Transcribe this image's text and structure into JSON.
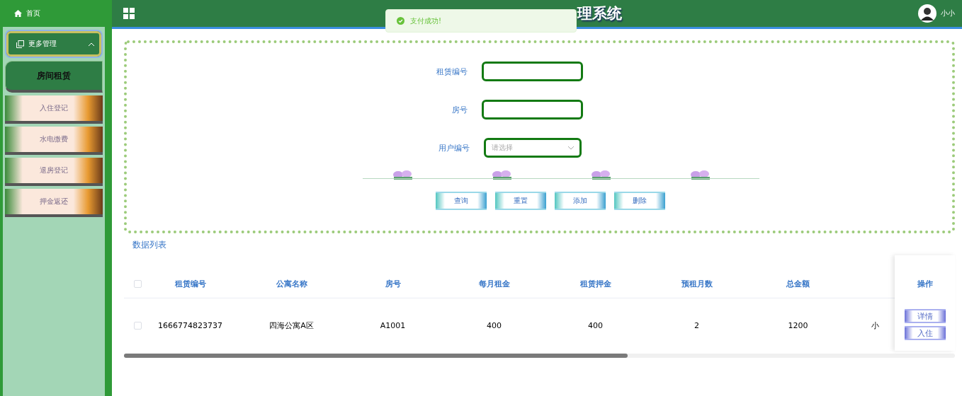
{
  "sidebar": {
    "home": "首页",
    "groups": [
      {
        "label": "更多管理",
        "expanded": true,
        "items": [
          {
            "label": "房间租赁",
            "selected": true
          },
          {
            "label": "入住登记",
            "selected": false
          },
          {
            "label": "水电缴费",
            "selected": false
          },
          {
            "label": "退房登记",
            "selected": false
          },
          {
            "label": "押金返还",
            "selected": false
          }
        ]
      }
    ]
  },
  "header": {
    "title": "理系统",
    "user": "小小"
  },
  "toast": {
    "kind": "success",
    "text": "支付成功!"
  },
  "form": {
    "fields": [
      {
        "kind": "text",
        "label": "租赁编号"
      },
      {
        "kind": "text",
        "label": "房号"
      },
      {
        "kind": "select",
        "label": "用户编号",
        "placeholder": "请选择"
      }
    ],
    "buttons": [
      "查询",
      "重置",
      "添加",
      "删除"
    ]
  },
  "table": {
    "title": "数据列表",
    "columns": [
      "租赁编号",
      "公寓名称",
      "房号",
      "每月租金",
      "租赁押金",
      "预租月数",
      "总金额"
    ],
    "header_checked": false,
    "rows": [
      {
        "checked": false,
        "cells": [
          "1666774823737",
          "四海公寓A区",
          "A1001",
          "400",
          "400",
          "2",
          "1200",
          "小"
        ]
      }
    ],
    "actions_title": "操作",
    "actions": [
      "详情",
      "入住"
    ]
  }
}
